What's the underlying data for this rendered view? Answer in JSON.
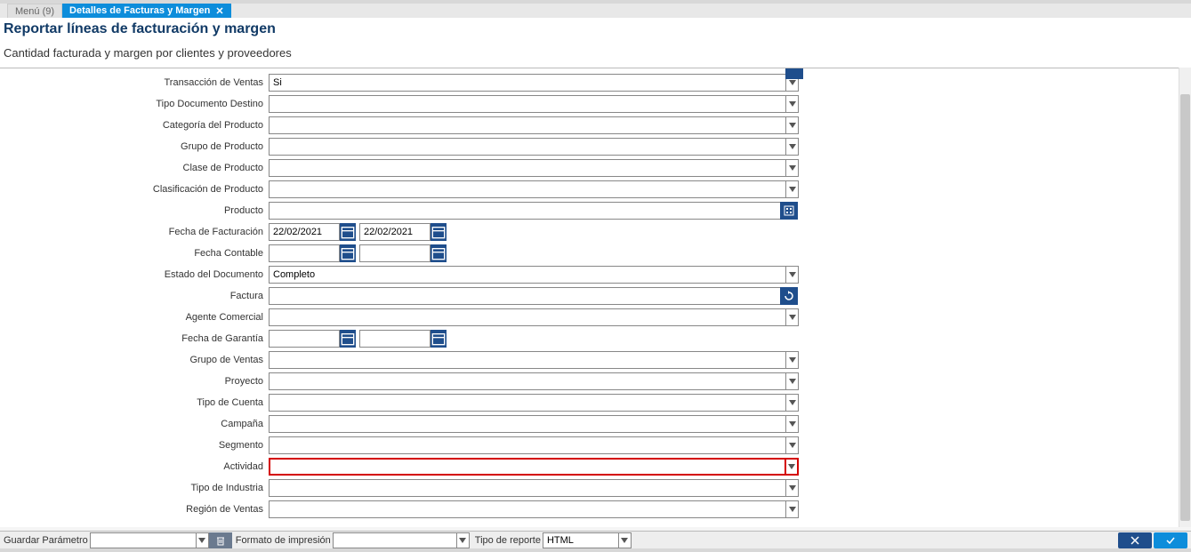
{
  "tabs": {
    "menu": "Menú (9)",
    "active": "Detalles de Facturas y Margen"
  },
  "header": {
    "title": "Reportar líneas de facturación y margen",
    "subtitle": "Cantidad facturada y margen por clientes y proveedores"
  },
  "form": {
    "transaccion_ventas": {
      "label": "Transacción de Ventas",
      "value": "Si"
    },
    "tipo_doc_destino": {
      "label": "Tipo Documento Destino",
      "value": ""
    },
    "categoria_producto": {
      "label": "Categoría del Producto",
      "value": ""
    },
    "grupo_producto": {
      "label": "Grupo de Producto",
      "value": ""
    },
    "clase_producto": {
      "label": "Clase de Producto",
      "value": ""
    },
    "clasificacion_producto": {
      "label": "Clasificación de Producto",
      "value": ""
    },
    "producto": {
      "label": "Producto",
      "value": ""
    },
    "fecha_facturacion": {
      "label": "Fecha de Facturación",
      "from": "22/02/2021",
      "to": "22/02/2021"
    },
    "fecha_contable": {
      "label": "Fecha Contable",
      "from": "",
      "to": ""
    },
    "estado_documento": {
      "label": "Estado del Documento",
      "value": "Completo"
    },
    "factura": {
      "label": "Factura",
      "value": ""
    },
    "agente_comercial": {
      "label": "Agente Comercial",
      "value": ""
    },
    "fecha_garantia": {
      "label": "Fecha de Garantía",
      "from": "",
      "to": ""
    },
    "grupo_ventas": {
      "label": "Grupo de Ventas",
      "value": ""
    },
    "proyecto": {
      "label": "Proyecto",
      "value": ""
    },
    "tipo_cuenta": {
      "label": "Tipo de Cuenta",
      "value": ""
    },
    "campana": {
      "label": "Campaña",
      "value": ""
    },
    "segmento": {
      "label": "Segmento",
      "value": ""
    },
    "actividad": {
      "label": "Actividad",
      "value": ""
    },
    "tipo_industria": {
      "label": "Tipo de Industria",
      "value": ""
    },
    "region_ventas": {
      "label": "Región de Ventas",
      "value": ""
    }
  },
  "footer": {
    "guardar_parametro": "Guardar Parámetro",
    "formato_impresion": "Formato de impresión",
    "tipo_reporte": "Tipo de reporte",
    "tipo_reporte_value": "HTML"
  }
}
